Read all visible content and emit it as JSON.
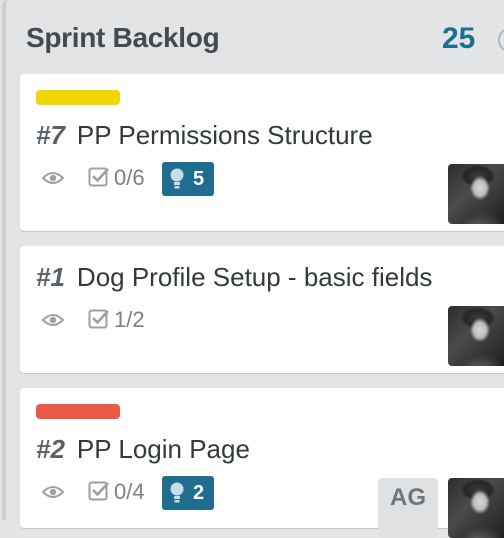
{
  "list": {
    "title": "Sprint Backlog",
    "count": "25",
    "cards": [
      {
        "label_color": "#f2d600",
        "number": "#7",
        "title": "PP Permissions Structure",
        "checklist": "0/6",
        "comments": "5"
      },
      {
        "label_color": "",
        "number": "#1",
        "title": "Dog Profile Setup - basic fields",
        "checklist": "1/2",
        "comments": ""
      },
      {
        "label_color": "#eb5a46",
        "number": "#2",
        "title": "PP Login Page",
        "checklist": "0/4",
        "comments": "2",
        "member_initials": "AG"
      }
    ]
  },
  "icons": {
    "watch": "eye-icon",
    "checklist": "checkbox-icon",
    "comments": "lightbulb-icon",
    "list_menu": "circle-icon"
  },
  "colors": {
    "accent": "#1f6d8f",
    "list_bg": "#e2e4e6",
    "card_bg": "#ffffff"
  }
}
